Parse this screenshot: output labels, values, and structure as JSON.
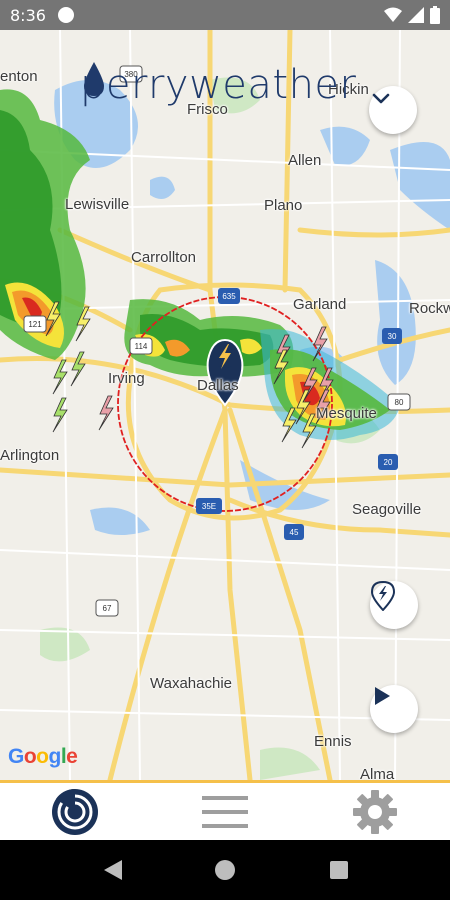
{
  "status_bar": {
    "time": "8:36"
  },
  "header": {
    "logo_left": "perry",
    "logo_right": "weather"
  },
  "map": {
    "cities": [
      {
        "name": "enton"
      },
      {
        "name": "Frisco"
      },
      {
        "name": "Hickin"
      },
      {
        "name": "Allen"
      },
      {
        "name": "Lewisville"
      },
      {
        "name": "Plano"
      },
      {
        "name": "Carrollton"
      },
      {
        "name": "Garland"
      },
      {
        "name": "Rockw"
      },
      {
        "name": "Irving"
      },
      {
        "name": "Dallas"
      },
      {
        "name": "Mesquite"
      },
      {
        "name": "Arlington"
      },
      {
        "name": "Seagoville"
      },
      {
        "name": "Waxahachie"
      },
      {
        "name": "Ennis"
      },
      {
        "name": "Alma"
      }
    ],
    "highway_shields": [
      "380",
      "121",
      "635",
      "114",
      "30",
      "80",
      "20",
      "35E",
      "45",
      "67"
    ],
    "attribution": "Google"
  },
  "bottom_nav": {
    "items": [
      "radar",
      "menu",
      "settings"
    ]
  },
  "icons": [
    "chevron-down-icon",
    "location-lightning-icon",
    "play-icon",
    "radar-icon",
    "menu-icon",
    "gear-icon"
  ],
  "colors": {
    "brand": "#1f3a6b",
    "accent": "#f5c04a",
    "radius": "#e02020"
  }
}
